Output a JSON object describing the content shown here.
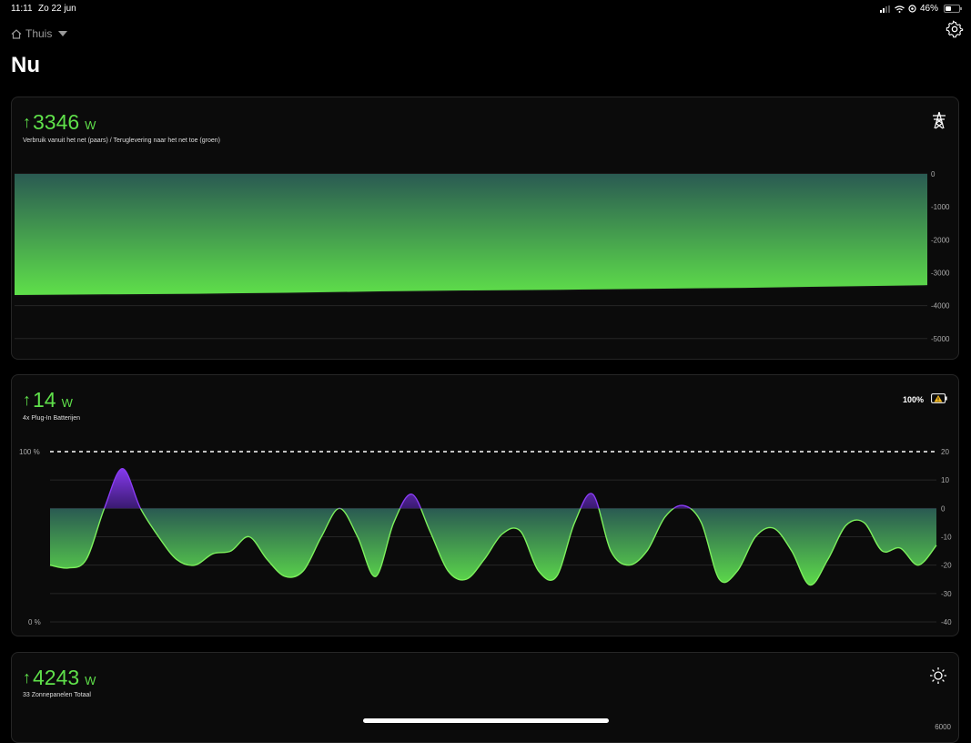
{
  "status": {
    "time": "11:11",
    "date": "Zo 22 jun",
    "battery": "46%",
    "battery_level": 0.46
  },
  "header": {
    "home_label": "Thuis",
    "title": "Nu"
  },
  "grid_card": {
    "value": "3346",
    "unit": "W",
    "subtitle": "Verbruik vanuit het net (paars) / Teruglevering naar het net toe (groen)",
    "icon": "power-pylon-icon",
    "chart_data": {
      "type": "area",
      "x": [
        0,
        10,
        20,
        30,
        40,
        50,
        60,
        70,
        80,
        90,
        100
      ],
      "values": [
        -3700,
        -3680,
        -3660,
        -3630,
        -3590,
        -3560,
        -3540,
        -3510,
        -3480,
        -3440,
        -3400
      ],
      "yticks": [
        "0",
        "-1000",
        "-2000",
        "-3000",
        "-4000",
        "-5000"
      ],
      "ylim": [
        -5200,
        0
      ],
      "colors": {
        "negative": "#5fe04a",
        "positive": "#7b2cf0"
      }
    }
  },
  "battery_card": {
    "value": "14",
    "unit": "W",
    "subtitle": "4x Plug-In Batterijen",
    "percent": "100%",
    "icon": "battery-warning-icon",
    "chart_data": {
      "type": "area",
      "left_labels": [
        "100 %",
        "0 %"
      ],
      "yticks": [
        "20",
        "10",
        "0",
        "-10",
        "-20",
        "-30",
        "-40"
      ],
      "ylim": [
        -40,
        20
      ],
      "dashed_line": 20,
      "values": [
        -20,
        -21,
        -18,
        0,
        14,
        0,
        -10,
        -18,
        -20,
        -16,
        -15,
        -10,
        -18,
        -24,
        -22,
        -10,
        0,
        -10,
        -24,
        -5,
        5,
        -8,
        -22,
        -25,
        -18,
        -9,
        -8,
        -22,
        -24,
        -5,
        5,
        -15,
        -20,
        -15,
        -3,
        1,
        -5,
        -25,
        -22,
        -10,
        -7,
        -15,
        -27,
        -18,
        -6,
        -5,
        -15,
        -14,
        -20,
        -13
      ],
      "colors": {
        "negative": "#5fe04a",
        "positive": "#7b2cf0"
      }
    }
  },
  "solar_card": {
    "value": "4243",
    "unit": "W",
    "subtitle": "33 Zonnepanelen Totaal",
    "icon": "sun-icon",
    "ytick": "6000"
  }
}
